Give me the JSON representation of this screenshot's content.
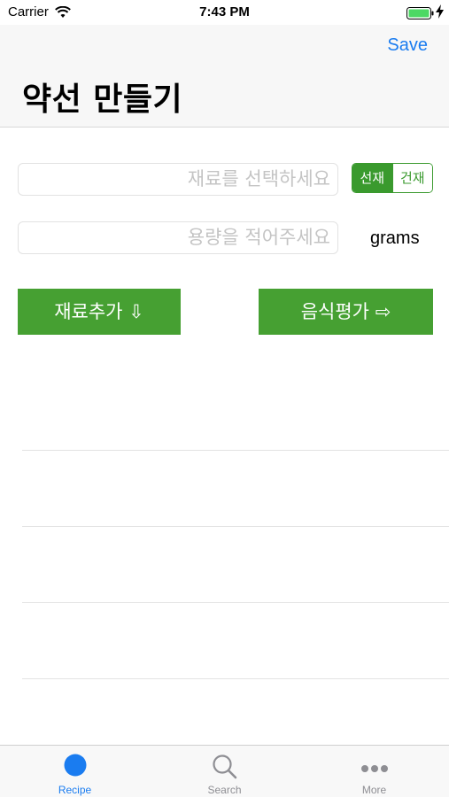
{
  "status_bar": {
    "carrier": "Carrier",
    "time": "7:43 PM",
    "icons": [
      "wifi-icon",
      "battery-icon",
      "charge-icon"
    ]
  },
  "nav": {
    "save_label": "Save",
    "title": "약선 만들기"
  },
  "form": {
    "ingredient_placeholder": "재료를 선택하세요",
    "amount_placeholder": "용량을 적어주세요",
    "segment": {
      "options": [
        "선재",
        "건재"
      ],
      "selected": "선재"
    },
    "unit_label": "grams",
    "add_button_label": "재료추가 ⇩",
    "evaluate_button_label": "음식평가 ⇨"
  },
  "tab_bar": {
    "tabs": [
      {
        "label": "Recipe",
        "icon": "circle-icon",
        "active": true
      },
      {
        "label": "Search",
        "icon": "search-icon",
        "active": false
      },
      {
        "label": "More",
        "icon": "more-icon",
        "active": false
      }
    ]
  },
  "colors": {
    "accent_blue": "#1a7cf0",
    "button_green": "#46a032",
    "segment_green": "#3a9a2e",
    "placeholder_gray": "#c4c4c4"
  }
}
